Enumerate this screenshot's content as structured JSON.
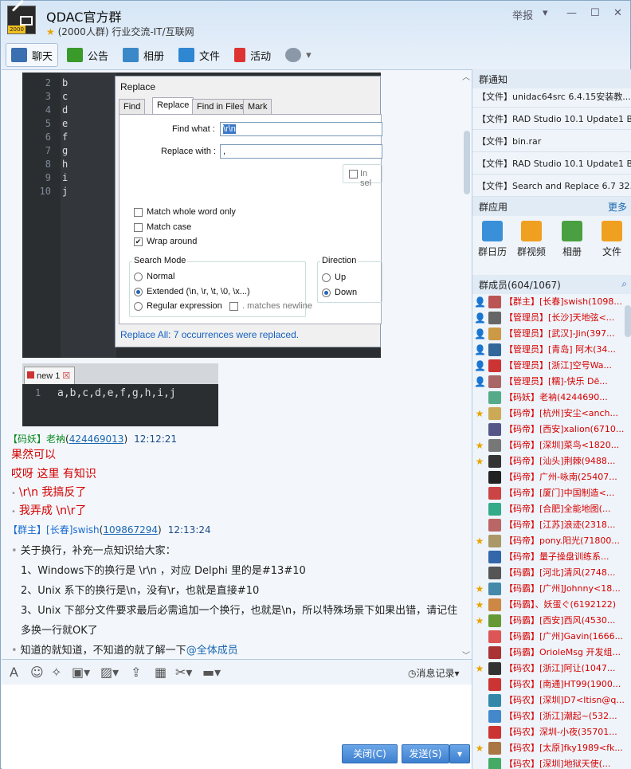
{
  "window": {
    "title": "QDAC官方群",
    "group_count": "(2000人群)",
    "category": "行业交流-IT/互联网",
    "report_label": "举报",
    "avatar_tag": "2000"
  },
  "tabs": [
    {
      "label": "聊天",
      "color": "#3a6fb0"
    },
    {
      "label": "公告",
      "color": "#3a9a2a"
    },
    {
      "label": "相册",
      "color": "#3a88c8"
    },
    {
      "label": "文件",
      "color": "#2f86d1"
    },
    {
      "label": "活动",
      "color": "#d33"
    }
  ],
  "screenshot1": {
    "line_numbers": [
      "2",
      "3",
      "4",
      "5",
      "6",
      "7",
      "8",
      "9",
      "10"
    ],
    "lines": [
      "b",
      "c",
      "d",
      "e",
      "f",
      "g",
      "h",
      "i",
      "j"
    ],
    "dialog_title": "Replace",
    "dialog_tabs": [
      "Find",
      "Replace",
      "Find in Files",
      "Mark"
    ],
    "find_label": "Find what :",
    "find_value": "\\r\\n",
    "replace_label": "Replace with :",
    "replace_value": ",",
    "in_sel": "In sel",
    "checks": [
      "Match whole word only",
      "Match case",
      "Wrap around"
    ],
    "search_mode_label": "Search Mode",
    "modes": [
      "Normal",
      "Extended (\\n, \\r, \\t, \\0, \\x...)",
      "Regular expression"
    ],
    "matches_newline": ". matches newline",
    "direction_label": "Direction",
    "directions": [
      "Up",
      "Down"
    ],
    "status": "Replace All: 7 occurrences were replaced."
  },
  "screenshot2": {
    "tab": "new 1",
    "line_number": "1",
    "line": "a,b,c,d,e,f,g,h,i,j"
  },
  "messages": [
    {
      "role": "【码妖】",
      "name": "老衲",
      "qq": "424469013",
      "time": "12:12:21",
      "lines": [
        "果然可以",
        "哎呀 这里 有知识",
        "\\r\\n 我搞反了",
        "我弄成 \\n\\r了"
      ]
    },
    {
      "role": "【群主】",
      "name": "[长春]swish",
      "qq": "109867294",
      "time": "12:13:24",
      "lines": [
        "关于换行，补充一点知识给大家：",
        "1、Windows下的换行是 \\r\\n ，对应 Delphi 里的是#13#10",
        "2、Unix 系下的换行是\\n，没有\\r，也就是直接#10",
        "3、Unix 下部分文件要求最后必需追加一个换行，也就是\\n，所以特殊场景下如果出错，请记住",
        "多换一行就OK了",
        "知道的就知道，不知道的就了解一下",
        "@全体成员"
      ]
    }
  ],
  "toolbar": {
    "history_label": "消息记录",
    "close_button": "关闭(C)",
    "send_button": "发送(S)"
  },
  "right": {
    "notice_title": "群通知",
    "notices": [
      "【文件】unidac64src 6.4.15安装教...",
      "【文件】RAD Studio 10.1 Update1 B...",
      "【文件】bin.rar",
      "【文件】RAD Studio 10.1 Update1 B...",
      "【文件】Search and Replace 6.7 32..."
    ],
    "apps_title": "群应用",
    "apps_more": "更多",
    "apps": [
      {
        "label": "群日历",
        "color": "#3a90d8"
      },
      {
        "label": "群视频",
        "color": "#f0a020"
      },
      {
        "label": "相册",
        "color": "#4aa040"
      },
      {
        "label": "文件",
        "color": "#f0a020"
      }
    ],
    "members_title": "群成员(604/1067)",
    "members": [
      {
        "role": "【群主】",
        "name": "[长春]swish(1098...",
        "color": "#b55",
        "star": "👤"
      },
      {
        "role": "【管理员】",
        "name": "[长沙]天地弦<...",
        "color": "#666",
        "star": "👤"
      },
      {
        "role": "【管理员】",
        "name": "[武汉]-Jin(397...",
        "color": "#c94",
        "star": "👤"
      },
      {
        "role": "【管理员】",
        "name": "[青岛] 阿木(34...",
        "color": "#369",
        "star": "👤"
      },
      {
        "role": "【管理员】",
        "name": "[浙江]空号Wa...",
        "color": "#c33",
        "star": "👤"
      },
      {
        "role": "【管理员】",
        "name": "[糯]-快乐 Dē...",
        "color": "#a66",
        "star": "👤"
      },
      {
        "role": "【码妖】",
        "name": "老衲(4244690...",
        "color": "#5a8",
        "star": ""
      },
      {
        "role": "【码帝】",
        "name": "[杭州]安尘<anch...",
        "color": "#ca5",
        "star": "★"
      },
      {
        "role": "【码帝】",
        "name": "[西安]xalion(6710...",
        "color": "#558",
        "star": ""
      },
      {
        "role": "【码帝】",
        "name": "[深圳]菜鸟<1820...",
        "color": "#777",
        "star": "★"
      },
      {
        "role": "【码帝】",
        "name": "[汕头]荆棘(9488...",
        "color": "#333",
        "star": "★"
      },
      {
        "role": "【码帝】",
        "name": "广州-咏南(25407...",
        "color": "#222",
        "star": ""
      },
      {
        "role": "【码帝】",
        "name": "[厦门]中国制造<...",
        "color": "#c44",
        "star": ""
      },
      {
        "role": "【码帝】",
        "name": "[合肥]全能地图(...",
        "color": "#3a8",
        "star": ""
      },
      {
        "role": "【码帝】",
        "name": "[江苏]浪迹(2318...",
        "color": "#b66",
        "star": ""
      },
      {
        "role": "【码帝】",
        "name": "pony.阳光(71800...",
        "color": "#a96",
        "star": "★"
      },
      {
        "role": "【码帝】",
        "name": "量子操盘训练系...",
        "color": "#36a",
        "star": ""
      },
      {
        "role": "【码霸】",
        "name": "[河北]清风(2748...",
        "color": "#555",
        "star": ""
      },
      {
        "role": "【码霸】",
        "name": "[广州]Johnny<18...",
        "color": "#48a",
        "star": "★"
      },
      {
        "role": "【码霸】",
        "name": "、妖蛋ぐ(6192122)",
        "color": "#c84",
        "star": "★"
      },
      {
        "role": "【码霸】",
        "name": "[西安]西风(4530...",
        "color": "#693",
        "star": "★"
      },
      {
        "role": "【码霸】",
        "name": "[广州]Gavin(1666...",
        "color": "#d55",
        "star": ""
      },
      {
        "role": "【码霸】",
        "name": "OrioleMsg 开发组...",
        "color": "#a33",
        "star": ""
      },
      {
        "role": "【码农】",
        "name": "[浙江]阿让(1047...",
        "color": "#333",
        "star": "★"
      },
      {
        "role": "【码农】",
        "name": "[南通]HT99(1900...",
        "color": "#c33",
        "star": ""
      },
      {
        "role": "【码农】",
        "name": "[深圳]D7<ltisn@q...",
        "color": "#38a",
        "star": ""
      },
      {
        "role": "【码农】",
        "name": "[浙江]潮起~(532...",
        "color": "#48c",
        "star": ""
      },
      {
        "role": "【码农】",
        "name": "深圳-小夜(35701...",
        "color": "#c33",
        "star": ""
      },
      {
        "role": "【码农】",
        "name": "[太原]fky1989<fk...",
        "color": "#a74",
        "star": "★"
      },
      {
        "role": "【码农】",
        "name": "[深圳]地狱天使(...",
        "color": "#4a6",
        "star": ""
      }
    ]
  }
}
